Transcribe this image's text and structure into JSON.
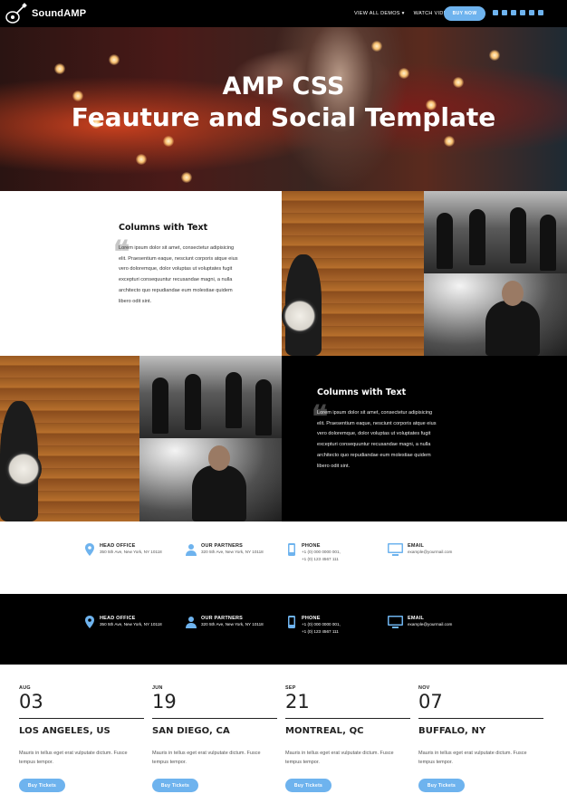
{
  "brand": {
    "name": "SoundAMP",
    "accent_color": "#6eb3ee"
  },
  "nav": {
    "links": [
      "VIEW ALL DEMOS ▾",
      "WATCH VIDEO"
    ],
    "cta": "BUY NOW",
    "social_icons": [
      "youtube-icon",
      "facebook-icon",
      "dribbble-icon",
      "linkedin-icon",
      "pinterest-icon",
      "twitter-icon"
    ]
  },
  "hero": {
    "title_line1": "AMP CSS",
    "title_line2": "Feauture and Social Template"
  },
  "columns": {
    "title": "Columns with Text",
    "body": "Lorem ipsum dolor sit amet, consectetur adipisicing elit. Praesentium eaque, nesciunt corporis atque eius vero doloremque, dolor voluptas ut voluptates fugit excepturi consequuntur recusandae magni, a nulla architecto quo repudiandae eum molestiae quidem libero odit sint."
  },
  "contact": [
    {
      "icon": "map-pin-icon",
      "label": "HEAD OFFICE",
      "lines": [
        "350 5th Ave, New York, NY 10118"
      ]
    },
    {
      "icon": "user-icon",
      "label": "OUR PARTNERS",
      "lines": [
        "320 5th Ave, New York, NY 10118"
      ]
    },
    {
      "icon": "phone-icon",
      "label": "PHONE",
      "lines": [
        "+1 (0) 000 0000 001,",
        "+1 (0) 123 4567 111"
      ]
    },
    {
      "icon": "monitor-icon",
      "label": "EMAIL",
      "lines": [
        "example@yourmail.com"
      ]
    }
  ],
  "events": [
    {
      "month": "AUG",
      "day": "03",
      "city": "LOS ANGELES, US",
      "desc": "Mauris in tellus eget erat vulputate dictum. Fusce tempus tempor.",
      "button": "Buy Tickets"
    },
    {
      "month": "JUN",
      "day": "19",
      "city": "SAN DIEGO, CA",
      "desc": "Mauris in tellus eget erat vulputate dictum. Fusce tempus tempor.",
      "button": "Buy Tickets"
    },
    {
      "month": "SEP",
      "day": "21",
      "city": "MONTREAL, QC",
      "desc": "Mauris in tellus eget erat vulputate dictum. Fusce tempus tempor.",
      "button": "Buy Tickets"
    },
    {
      "month": "NOV",
      "day": "07",
      "city": "BUFFALO, NY",
      "desc": "Mauris in tellus eget erat vulputate dictum. Fusce tempus tempor.",
      "button": "Buy Tickets"
    }
  ]
}
